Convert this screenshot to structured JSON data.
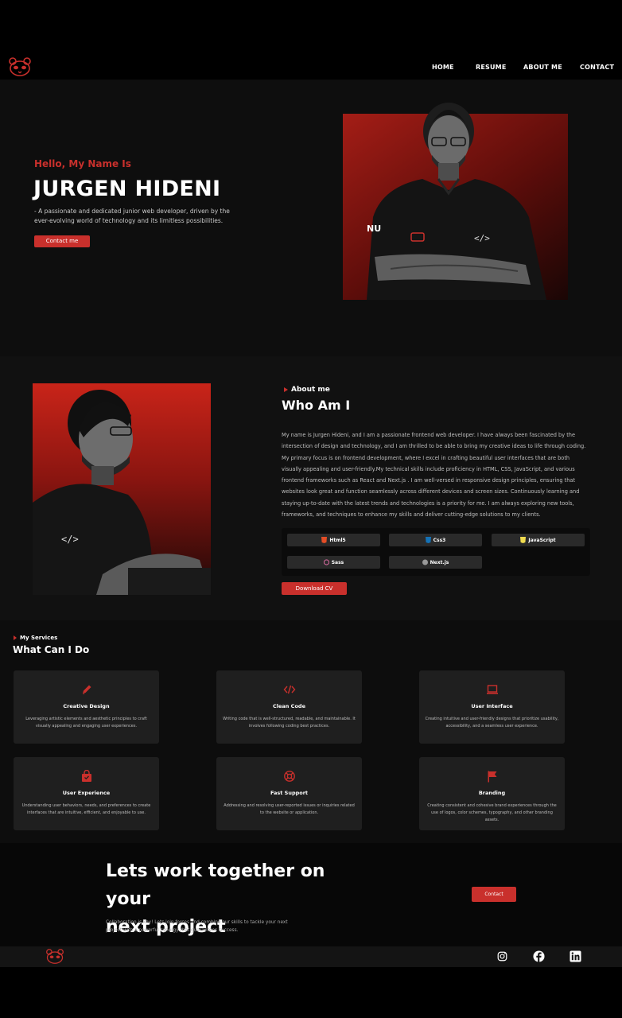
{
  "nav": {
    "logo": "panda-logo-icon",
    "links": [
      "HOME",
      "RESUME",
      "ABOUT ME",
      "CONTACT"
    ]
  },
  "hero": {
    "greeting": "Hello, My Name Is",
    "name": "JURGEN HIDENI",
    "description": "- A passionate and dedicated junior web developer, driven by the ever-evolving world of technology and its limitless possibilities.",
    "button": "Contact me"
  },
  "about": {
    "kicker": "About me",
    "title": "Who Am I",
    "text": "My name is Jurgen Hideni, and I am a passionate frontend web developer. I have always been fascinated by the intersection of design and technology, and I am thrilled to be able to bring my creative ideas to life through coding. My primary focus is on frontend development, where I excel in crafting beautiful user interfaces that are both visually appealing and user-friendly.My technical skills include proficiency in HTML, CSS, JavaScript, and various frontend frameworks such as React and Next.js . I am well-versed in responsive design principles, ensuring that websites look great and function seamlessly across different devices and screen sizes. Continuously learning and staying up-to-date with the latest trends and technologies is a priority for me. I am always exploring new tools, frameworks, and techniques to enhance my skills and deliver cutting-edge solutions to my clients.",
    "skills": [
      "Html5",
      "Css3",
      "JavaScript",
      "Sass",
      "Next.js"
    ],
    "button": "Download CV"
  },
  "services": {
    "kicker": "My Services",
    "title": "What Can I Do",
    "cards": [
      {
        "icon": "pencil-icon",
        "title": "Creative Design",
        "desc": "Leveraging artistic elements and aesthetic principles to craft visually appealing and engaging user experiences."
      },
      {
        "icon": "code-icon",
        "title": "Clean Code",
        "desc": "Writing code that is well-structured, readable, and maintainable. It involves following coding best practices."
      },
      {
        "icon": "laptop-icon",
        "title": "User Interface",
        "desc": "Creating intuitive and user-friendly designs that prioritize usability, accessibility, and a seamless user experience."
      },
      {
        "icon": "shopping-bag-icon",
        "title": "User Experience",
        "desc": "Understanding user behaviors, needs, and preferences to create interfaces that are intuitive, efficient, and enjoyable to use."
      },
      {
        "icon": "support-icon",
        "title": "Fast Support",
        "desc": "Addressing and resolving user-reported issues or inquiries related to the website or application."
      },
      {
        "icon": "flag-icon",
        "title": "Branding",
        "desc": "Creating consistent and cohesive brand experiences through the use of logos, color schemes, typography, and other branding assets."
      }
    ]
  },
  "cta": {
    "title_line1": "Lets work together on your",
    "title_line2": "next project",
    "desc": "Collaboration is key! Lets join forces and combine our skills to tackle your next project with a powerful synergy that guarantees success.",
    "button": "Contact"
  },
  "footer": {
    "socials": [
      "instagram-icon",
      "facebook-icon",
      "linkedin-icon"
    ]
  },
  "colors": {
    "accent": "#c9302c",
    "background": "#0e0e0e",
    "card": "#1f1f1f"
  }
}
